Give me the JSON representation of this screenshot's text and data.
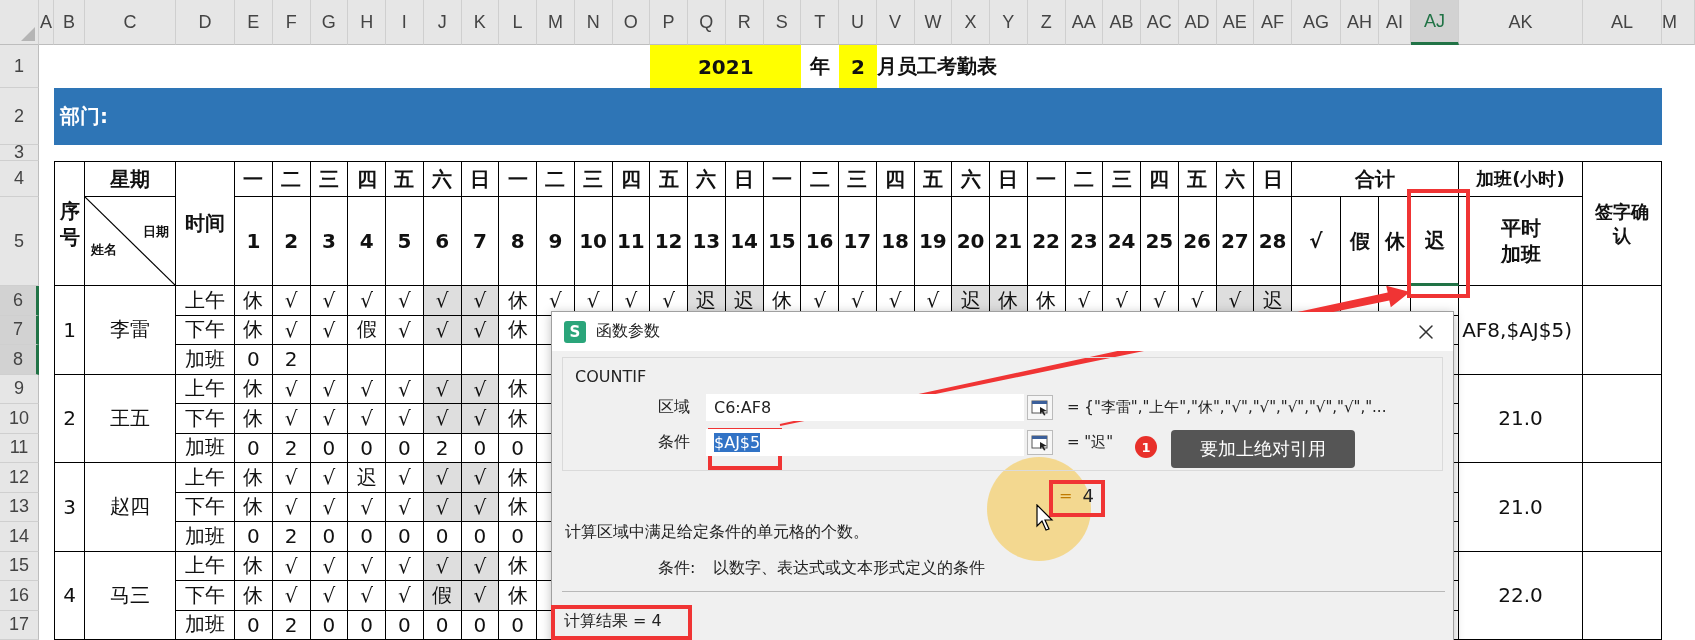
{
  "column_headers": [
    {
      "label": "A",
      "selected": false
    },
    {
      "label": "B",
      "selected": false
    },
    {
      "label": "C",
      "selected": false
    },
    {
      "label": "D",
      "selected": false
    },
    {
      "label": "E",
      "selected": false
    },
    {
      "label": "F",
      "selected": false
    },
    {
      "label": "G",
      "selected": false
    },
    {
      "label": "H",
      "selected": false
    },
    {
      "label": "I",
      "selected": false
    },
    {
      "label": "J",
      "selected": false
    },
    {
      "label": "K",
      "selected": false
    },
    {
      "label": "L",
      "selected": false
    },
    {
      "label": "M",
      "selected": false
    },
    {
      "label": "N",
      "selected": false
    },
    {
      "label": "O",
      "selected": false
    },
    {
      "label": "P",
      "selected": false
    },
    {
      "label": "Q",
      "selected": false
    },
    {
      "label": "R",
      "selected": false
    },
    {
      "label": "S",
      "selected": false
    },
    {
      "label": "T",
      "selected": false
    },
    {
      "label": "U",
      "selected": false
    },
    {
      "label": "V",
      "selected": false
    },
    {
      "label": "W",
      "selected": false
    },
    {
      "label": "X",
      "selected": false
    },
    {
      "label": "Y",
      "selected": false
    },
    {
      "label": "Z",
      "selected": false
    },
    {
      "label": "AA",
      "selected": false
    },
    {
      "label": "AB",
      "selected": false
    },
    {
      "label": "AC",
      "selected": false
    },
    {
      "label": "AD",
      "selected": false
    },
    {
      "label": "AE",
      "selected": false
    },
    {
      "label": "AF",
      "selected": false
    },
    {
      "label": "AG",
      "selected": false
    },
    {
      "label": "AH",
      "selected": false
    },
    {
      "label": "AI",
      "selected": false
    },
    {
      "label": "AJ",
      "selected": true
    },
    {
      "label": "AK",
      "selected": false
    },
    {
      "label": "AL",
      "selected": false
    },
    {
      "label": "M",
      "selected": false
    }
  ],
  "row_headers": [
    {
      "label": "1",
      "selected": false
    },
    {
      "label": "2",
      "selected": false
    },
    {
      "label": "3",
      "selected": false
    },
    {
      "label": "4",
      "selected": false
    },
    {
      "label": "5",
      "selected": false
    },
    {
      "label": "6",
      "selected": true
    },
    {
      "label": "7",
      "selected": true
    },
    {
      "label": "8",
      "selected": true
    },
    {
      "label": "9",
      "selected": false
    },
    {
      "label": "10",
      "selected": false
    },
    {
      "label": "11",
      "selected": false
    },
    {
      "label": "12",
      "selected": false
    },
    {
      "label": "13",
      "selected": false
    },
    {
      "label": "14",
      "selected": false
    },
    {
      "label": "15",
      "selected": false
    },
    {
      "label": "16",
      "selected": false
    },
    {
      "label": "17",
      "selected": false
    }
  ],
  "title": {
    "year": "2021",
    "year_suffix": "年",
    "month": "2",
    "month_suffix": "月员工考勤表"
  },
  "department_label": "部门:",
  "header": {
    "number": "序号",
    "weekday": "星期",
    "name": "姓名",
    "date": "日期",
    "time": "时间",
    "totals": "合计",
    "overtime": "加班(小时)",
    "overtime_sub": "平时加班",
    "sign": "签字确认"
  },
  "days": [
    {
      "weekday": "一",
      "date": "1",
      "weekend": false
    },
    {
      "weekday": "二",
      "date": "2",
      "weekend": false
    },
    {
      "weekday": "三",
      "date": "3",
      "weekend": false
    },
    {
      "weekday": "四",
      "date": "4",
      "weekend": false
    },
    {
      "weekday": "五",
      "date": "5",
      "weekend": false
    },
    {
      "weekday": "六",
      "date": "6",
      "weekend": true
    },
    {
      "weekday": "日",
      "date": "7",
      "weekend": true
    },
    {
      "weekday": "一",
      "date": "8",
      "weekend": false
    },
    {
      "weekday": "二",
      "date": "9",
      "weekend": false
    },
    {
      "weekday": "三",
      "date": "10",
      "weekend": false
    },
    {
      "weekday": "四",
      "date": "11",
      "weekend": false
    },
    {
      "weekday": "五",
      "date": "12",
      "weekend": false
    },
    {
      "weekday": "六",
      "date": "13",
      "weekend": true
    },
    {
      "weekday": "日",
      "date": "14",
      "weekend": true
    },
    {
      "weekday": "一",
      "date": "15",
      "weekend": false
    },
    {
      "weekday": "二",
      "date": "16",
      "weekend": false
    },
    {
      "weekday": "三",
      "date": "17",
      "weekend": false
    },
    {
      "weekday": "四",
      "date": "18",
      "weekend": false
    },
    {
      "weekday": "五",
      "date": "19",
      "weekend": false
    },
    {
      "weekday": "六",
      "date": "20",
      "weekend": true
    },
    {
      "weekday": "日",
      "date": "21",
      "weekend": true
    },
    {
      "weekday": "一",
      "date": "22",
      "weekend": false
    },
    {
      "weekday": "二",
      "date": "23",
      "weekend": false
    },
    {
      "weekday": "三",
      "date": "24",
      "weekend": false
    },
    {
      "weekday": "四",
      "date": "25",
      "weekend": false
    },
    {
      "weekday": "五",
      "date": "26",
      "weekend": false
    },
    {
      "weekday": "六",
      "date": "27",
      "weekend": true
    },
    {
      "weekday": "日",
      "date": "28",
      "weekend": true
    }
  ],
  "totals": [
    {
      "label": "√",
      "selected": false
    },
    {
      "label": "假",
      "selected": false
    },
    {
      "label": "休",
      "selected": false
    },
    {
      "label": "迟",
      "selected": true
    }
  ],
  "employees": [
    {
      "no": "1",
      "name": "李雷",
      "overtime": {
        "text": "AF8,$AJ$5)",
        "editing": true
      },
      "slots": [
        {
          "label": "上午",
          "kind": "attendance",
          "cells": [
            "休",
            "√",
            "√",
            "√",
            "√",
            "√",
            "√",
            "休",
            "√",
            "√",
            "√",
            "√",
            "迟",
            "迟",
            "休",
            "√",
            "√",
            "√",
            "√",
            "迟",
            "休",
            "休",
            "√",
            "√",
            "√",
            "√",
            "√",
            "迟"
          ]
        },
        {
          "label": "下午",
          "kind": "attendance",
          "cells": [
            "休",
            "√",
            "√",
            "假",
            "√",
            "√",
            "√",
            "休"
          ]
        },
        {
          "label": "加班",
          "kind": "overtime",
          "cells": [
            "0",
            "2"
          ]
        }
      ]
    },
    {
      "no": "2",
      "name": "王五",
      "overtime": {
        "text": "21.0",
        "editing": false
      },
      "slots": [
        {
          "label": "上午",
          "kind": "attendance",
          "cells": [
            "休",
            "√",
            "√",
            "√",
            "√",
            "√",
            "√",
            "休"
          ]
        },
        {
          "label": "下午",
          "kind": "attendance",
          "cells": [
            "休",
            "√",
            "√",
            "√",
            "√",
            "√",
            "√",
            "休"
          ]
        },
        {
          "label": "加班",
          "kind": "overtime",
          "cells": [
            "0",
            "2",
            "0",
            "0",
            "0",
            "2",
            "0",
            "0"
          ]
        }
      ]
    },
    {
      "no": "3",
      "name": "赵四",
      "overtime": {
        "text": "21.0",
        "editing": false
      },
      "slots": [
        {
          "label": "上午",
          "kind": "attendance",
          "cells": [
            "休",
            "√",
            "√",
            "迟",
            "√",
            "√",
            "√",
            "休"
          ]
        },
        {
          "label": "下午",
          "kind": "attendance",
          "cells": [
            "休",
            "√",
            "√",
            "√",
            "√",
            "√",
            "√",
            "休"
          ]
        },
        {
          "label": "加班",
          "kind": "overtime",
          "cells": [
            "0",
            "2",
            "0",
            "0",
            "0",
            "0",
            "0",
            "0"
          ]
        }
      ]
    },
    {
      "no": "4",
      "name": "马三",
      "overtime": {
        "text": "22.0",
        "editing": false
      },
      "slots": [
        {
          "label": "上午",
          "kind": "attendance",
          "cells": [
            "休",
            "√",
            "√",
            "√",
            "√",
            "√",
            "√",
            "休"
          ]
        },
        {
          "label": "下午",
          "kind": "attendance",
          "cells": [
            "休",
            "√",
            "√",
            "√",
            "√",
            "假",
            "√",
            "休"
          ]
        },
        {
          "label": "加班",
          "kind": "overtime",
          "cells": [
            "0",
            "2",
            "0",
            "0",
            "0",
            "0",
            "0",
            "0"
          ]
        }
      ]
    }
  ],
  "dialog": {
    "logo": "S",
    "title": "函数参数",
    "function": "COUNTIF",
    "args": [
      {
        "label": "区域",
        "value": "C6:AF8",
        "value_selected": false,
        "preview": "= {\"李雷\",\"上午\",\"休\",\"√\",\"√\",\"√\",\"√\",\"√\",\"..."
      },
      {
        "label": "条件",
        "value": "$AJ$5",
        "value_selected": true,
        "preview": "= \"迟\""
      }
    ],
    "result_sign": "=",
    "result": "4",
    "description": "计算区域中满足给定条件的单元格的个数。",
    "arg_help_label": "条件:",
    "arg_help": "以数字、表达式或文本形式定义的条件",
    "calc_result": "计算结果 = 4"
  },
  "annotation": {
    "step": "1",
    "text": "要加上绝对引用"
  }
}
